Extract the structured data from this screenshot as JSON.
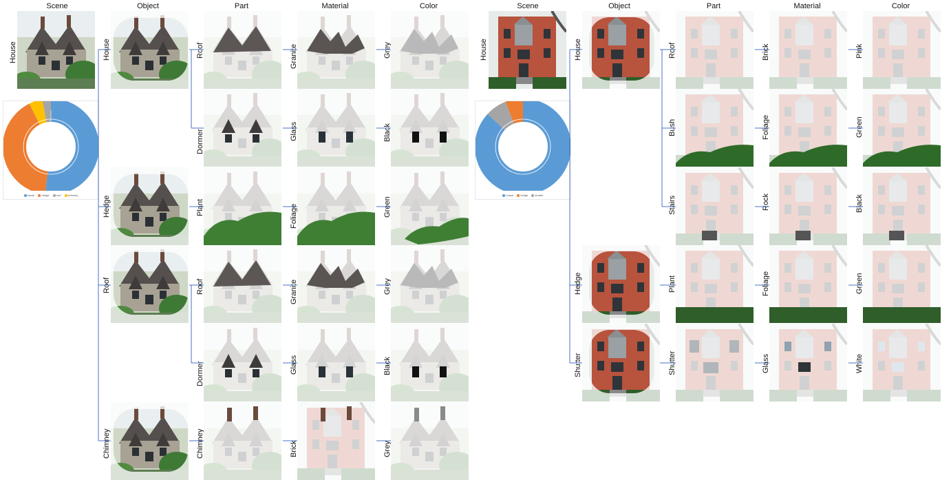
{
  "left_panel": {
    "headers": [
      "Scene",
      "Object",
      "Part",
      "Material",
      "Color"
    ],
    "scene_label": "House",
    "objects": [
      "House",
      "Hedge",
      "Roof",
      "Chimney"
    ],
    "rows": [
      {
        "part": "Roof",
        "material": "Granite",
        "color": "Grey"
      },
      {
        "part": "Dormer",
        "material": "Glass",
        "color": "Black"
      },
      {
        "part": "Plant",
        "material": "Foliage",
        "color": "Green"
      },
      {
        "part": "Roof",
        "material": "Granite",
        "color": "Grey"
      },
      {
        "part": "Dormer",
        "material": "Glass",
        "color": "Black"
      },
      {
        "part": "Chimney",
        "material": "Brick",
        "color": "Grey"
      }
    ],
    "legend": [
      "house",
      "hedge",
      "roof",
      "chimney"
    ],
    "colors": [
      "#5b9bd5",
      "#ed7d31",
      "#a5a5a5",
      "#ffc000"
    ]
  },
  "right_panel": {
    "headers": [
      "Scene",
      "Object",
      "Part",
      "Material",
      "Color"
    ],
    "scene_label": "House",
    "objects": [
      "House",
      "Hedge",
      "Shutter"
    ],
    "rows": [
      {
        "part": "Roof",
        "material": "Brick",
        "color": "Pink"
      },
      {
        "part": "Bush",
        "material": "Foliage",
        "color": "Green"
      },
      {
        "part": "Stairs",
        "material": "Rock",
        "color": "Black"
      },
      {
        "part": "Plant",
        "material": "Foliage",
        "color": "Green"
      },
      {
        "part": "Shutter",
        "material": "Glass",
        "color": "White"
      }
    ],
    "legend": [
      "house",
      "hedge",
      "shutter"
    ],
    "colors": [
      "#5b9bd5",
      "#ed7d31",
      "#a5a5a5"
    ]
  }
}
